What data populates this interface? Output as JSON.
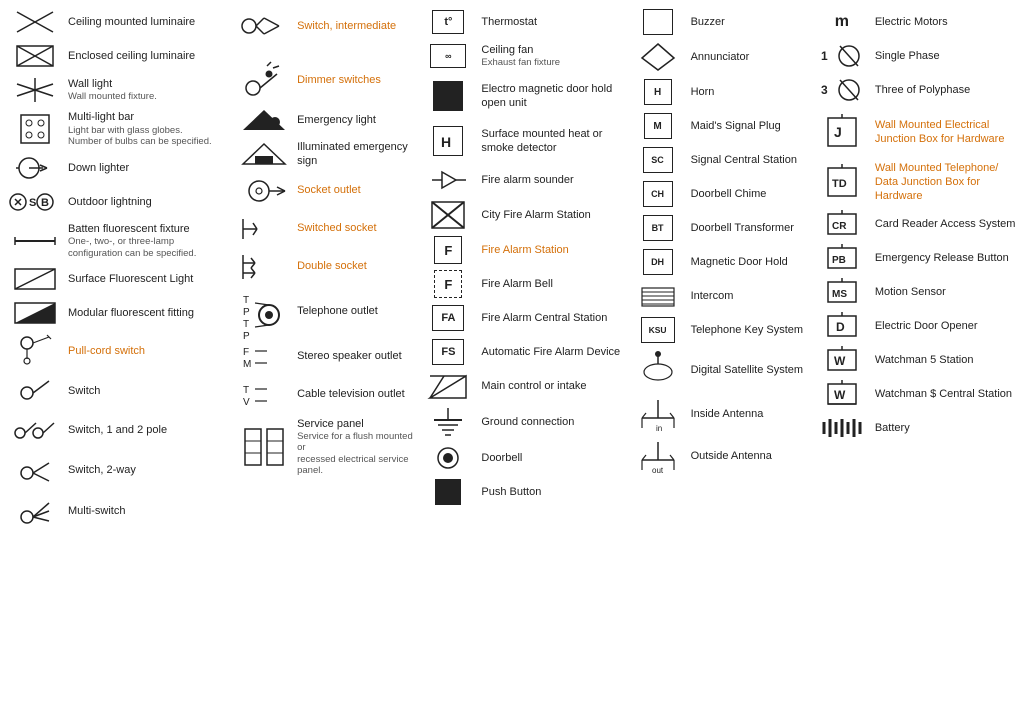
{
  "col1": [
    {
      "id": "ceiling-luminaire",
      "label": "Ceiling mounted luminaire",
      "sub": "",
      "color": "black"
    },
    {
      "id": "enclosed-ceiling",
      "label": "Enclosed ceiling luminaire",
      "sub": "",
      "color": "black"
    },
    {
      "id": "wall-light",
      "label": "Wall light",
      "sub": "Wall mounted fixture.",
      "color": "black"
    },
    {
      "id": "multilight-bar",
      "label": "Multi-light bar",
      "sub": "Light bar with glass globes.\nNumber of bulbs can be specified.",
      "color": "black"
    },
    {
      "id": "down-lighter",
      "label": "Down lighter",
      "sub": "",
      "color": "black"
    },
    {
      "id": "outdoor-lightning",
      "label": "Outdoor lightning",
      "sub": "",
      "color": "black"
    },
    {
      "id": "batten-fluorescent",
      "label": "Batten fluorescent fixture",
      "sub": "One-, two-, or three-lamp\nconfiguration can be specified.",
      "color": "black"
    },
    {
      "id": "surface-fluorescent",
      "label": "Surface Fluorescent Light",
      "sub": "",
      "color": "black"
    },
    {
      "id": "modular-fluorescent",
      "label": "Modular fluorescent fitting",
      "sub": "",
      "color": "black"
    },
    {
      "id": "pull-cord",
      "label": "Pull-cord switch",
      "sub": "",
      "color": "orange"
    },
    {
      "id": "switch",
      "label": "Switch",
      "sub": "",
      "color": "black"
    },
    {
      "id": "switch-12pole",
      "label": "Switch, 1 and 2 pole",
      "sub": "",
      "color": "black"
    },
    {
      "id": "switch-2way",
      "label": "Switch, 2-way",
      "sub": "",
      "color": "black"
    },
    {
      "id": "multi-switch",
      "label": "Multi-switch",
      "sub": "",
      "color": "black"
    }
  ],
  "col2": [
    {
      "id": "switch-intermediate",
      "label": "Switch, intermediate",
      "sub": "",
      "color": "orange"
    },
    {
      "id": "dimmer-switches",
      "label": "Dimmer switches",
      "sub": "",
      "color": "orange"
    },
    {
      "id": "emergency-light",
      "label": "Emergency light",
      "sub": "",
      "color": "black"
    },
    {
      "id": "illuminated-emergency",
      "label": "Illuminated emergency sign",
      "sub": "",
      "color": "black"
    },
    {
      "id": "socket-outlet",
      "label": "Socket outlet",
      "sub": "",
      "color": "orange"
    },
    {
      "id": "switched-socket",
      "label": "Switched socket",
      "sub": "",
      "color": "orange"
    },
    {
      "id": "double-socket",
      "label": "Double socket",
      "sub": "",
      "color": "orange"
    },
    {
      "id": "telephone-outlet",
      "label": "Telephone outlet",
      "sub": "",
      "color": "black"
    },
    {
      "id": "stereo-speaker",
      "label": "Stereo speaker outlet",
      "sub": "",
      "color": "black"
    },
    {
      "id": "cable-tv",
      "label": "Cable television outlet",
      "sub": "",
      "color": "black"
    },
    {
      "id": "service-panel",
      "label": "Service panel",
      "sub": "Service for a flush mounted or\nrecessed electrical service panel.",
      "color": "black"
    }
  ],
  "col3": [
    {
      "id": "thermostat",
      "label": "Thermostat",
      "sub": "",
      "color": "black"
    },
    {
      "id": "ceiling-fan",
      "label": "Ceiling fan",
      "sub": "Exhaust fan fixture",
      "color": "black"
    },
    {
      "id": "em-door",
      "label": "Electro magnetic door hold open unit",
      "sub": "",
      "color": "black"
    },
    {
      "id": "surface-heat",
      "label": "Surface mounted heat or smoke detector",
      "sub": "",
      "color": "black"
    },
    {
      "id": "fire-alarm-sounder",
      "label": "Fire alarm sounder",
      "sub": "",
      "color": "black"
    },
    {
      "id": "city-fire-alarm",
      "label": "City Fire Alarm Station",
      "sub": "",
      "color": "black"
    },
    {
      "id": "fire-alarm-station",
      "label": "Fire Alarm Station",
      "sub": "",
      "color": "orange"
    },
    {
      "id": "fire-alarm-bell",
      "label": "Fire Alarm Bell",
      "sub": "",
      "color": "black"
    },
    {
      "id": "fire-alarm-central",
      "label": "Fire Alarm Central Station",
      "sub": "",
      "color": "black"
    },
    {
      "id": "auto-fire-alarm",
      "label": "Automatic Fire Alarm Device",
      "sub": "",
      "color": "black"
    },
    {
      "id": "main-control",
      "label": "Main control or intake",
      "sub": "",
      "color": "black"
    },
    {
      "id": "ground-connection",
      "label": "Ground connection",
      "sub": "",
      "color": "black"
    },
    {
      "id": "doorbell",
      "label": "Doorbell",
      "sub": "",
      "color": "black"
    },
    {
      "id": "push-button",
      "label": "Push Button",
      "sub": "",
      "color": "black"
    }
  ],
  "col4": [
    {
      "id": "buzzer",
      "label": "Buzzer",
      "sub": "",
      "color": "black"
    },
    {
      "id": "annunciator",
      "label": "Annunciator",
      "sub": "",
      "color": "black"
    },
    {
      "id": "horn",
      "label": "Horn",
      "sub": "",
      "color": "black"
    },
    {
      "id": "maids-signal",
      "label": "Maid's Signal Plug",
      "sub": "",
      "color": "black"
    },
    {
      "id": "signal-central",
      "label": "Signal Central Station",
      "sub": "",
      "color": "black"
    },
    {
      "id": "doorbell-chime",
      "label": "Doorbell Chime",
      "sub": "",
      "color": "black"
    },
    {
      "id": "doorbell-transformer",
      "label": "Doorbell Transformer",
      "sub": "",
      "color": "black"
    },
    {
      "id": "magnetic-door",
      "label": "Magnetic Door Hold",
      "sub": "",
      "color": "black"
    },
    {
      "id": "intercom",
      "label": "Intercom",
      "sub": "",
      "color": "black"
    },
    {
      "id": "telephone-key",
      "label": "Telephone Key System",
      "sub": "",
      "color": "black"
    },
    {
      "id": "digital-satellite",
      "label": "Digital Satellite System",
      "sub": "",
      "color": "black"
    },
    {
      "id": "inside-antenna",
      "label": "Inside Antenna",
      "sub": "",
      "color": "black"
    },
    {
      "id": "outside-antenna",
      "label": "Outside Antenna",
      "sub": "",
      "color": "black"
    }
  ],
  "col5": [
    {
      "id": "electric-motors",
      "label": "Electric Motors",
      "sub": "",
      "color": "black"
    },
    {
      "id": "single-phase",
      "label": "Single Phase",
      "sub": "",
      "color": "black"
    },
    {
      "id": "three-polyphase",
      "label": "Three of Polyphase",
      "sub": "",
      "color": "black"
    },
    {
      "id": "wall-junction",
      "label": "Wall Mounted Electrical Junction Box for Hardware",
      "sub": "",
      "color": "orange"
    },
    {
      "id": "wall-telephone",
      "label": "Wall Mounted Telephone/ Data Junction Box for Hardware",
      "sub": "",
      "color": "orange"
    },
    {
      "id": "card-reader",
      "label": "Card Reader Access System",
      "sub": "",
      "color": "black"
    },
    {
      "id": "emergency-release",
      "label": "Emergency Release Button",
      "sub": "",
      "color": "black"
    },
    {
      "id": "motion-sensor",
      "label": "Motion Sensor",
      "sub": "",
      "color": "black"
    },
    {
      "id": "electric-door",
      "label": "Electric Door Opener",
      "sub": "",
      "color": "black"
    },
    {
      "id": "watchmans-station",
      "label": "Watchman's Station",
      "sub": "",
      "color": "black"
    },
    {
      "id": "watchmans-central",
      "label": "Watchman's Central Station",
      "sub": "",
      "color": "black"
    },
    {
      "id": "battery",
      "label": "Battery",
      "sub": "",
      "color": "black"
    }
  ]
}
